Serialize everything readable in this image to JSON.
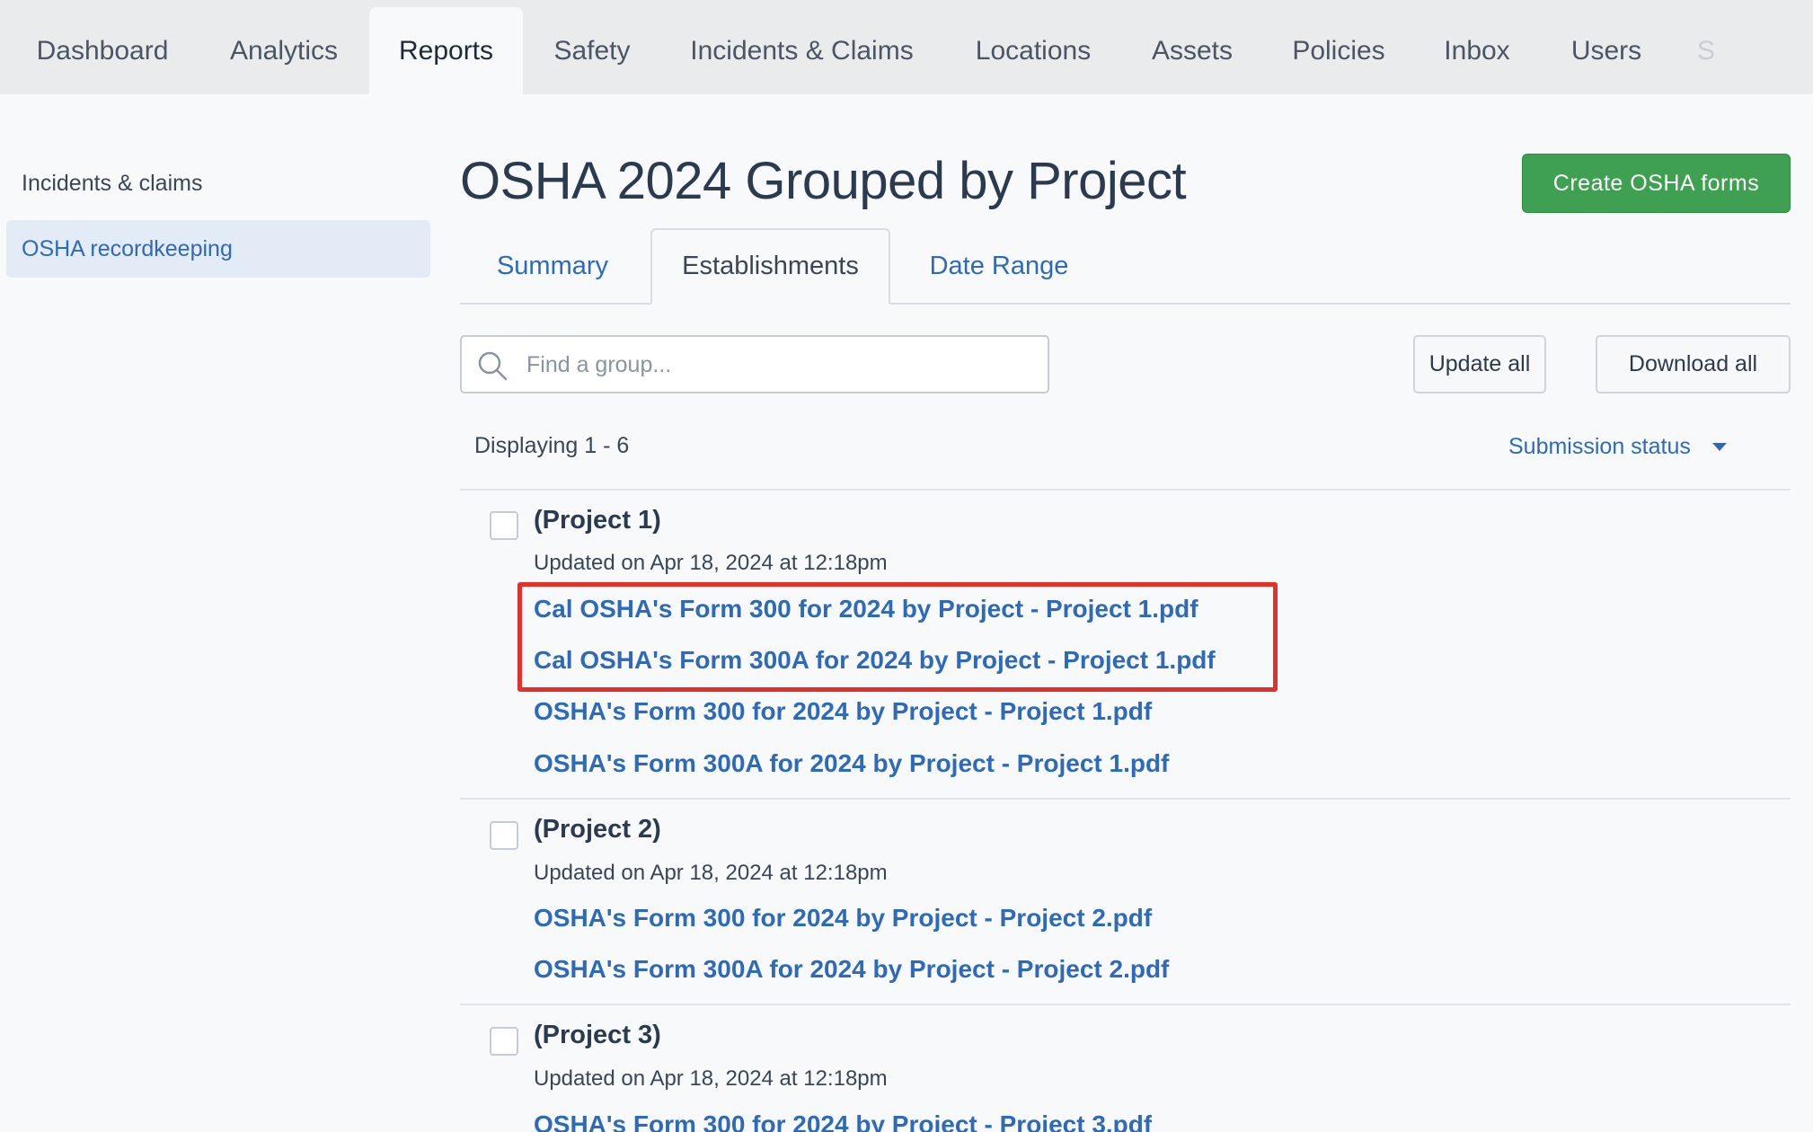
{
  "topnav": {
    "tabs": [
      {
        "label": "Dashboard"
      },
      {
        "label": "Analytics"
      },
      {
        "label": "Reports"
      },
      {
        "label": "Safety"
      },
      {
        "label": "Incidents & Claims"
      },
      {
        "label": "Locations"
      },
      {
        "label": "Assets"
      },
      {
        "label": "Policies"
      },
      {
        "label": "Inbox"
      },
      {
        "label": "Users"
      },
      {
        "label": "S"
      }
    ],
    "active": "Reports"
  },
  "sidebar": {
    "items": [
      {
        "label": "Incidents & claims"
      },
      {
        "label": "OSHA recordkeeping"
      }
    ]
  },
  "main": {
    "title": "OSHA 2024 Grouped by Project",
    "create_button": "Create OSHA forms",
    "tabs": [
      {
        "label": "Summary"
      },
      {
        "label": "Establishments"
      },
      {
        "label": "Date Range"
      }
    ],
    "search_placeholder": "Find a group...",
    "update_all": "Update all",
    "download_all": "Download all",
    "displaying": "Displaying 1 - 6",
    "status_filter": "Submission status",
    "groups": [
      {
        "title": "(Project 1)",
        "updated": "Updated on Apr 18, 2024 at 12:18pm",
        "files": [
          "Cal OSHA's Form 300 for 2024 by Project - Project 1.pdf",
          "Cal OSHA's Form 300A for 2024 by Project - Project 1.pdf",
          "OSHA's Form 300 for 2024 by Project - Project 1.pdf",
          "OSHA's Form 300A for 2024 by Project - Project 1.pdf"
        ]
      },
      {
        "title": "(Project 2)",
        "updated": "Updated on Apr 18, 2024 at 12:18pm",
        "files": [
          "OSHA's Form 300 for 2024 by Project - Project 2.pdf",
          "OSHA's Form 300A for 2024 by Project - Project 2.pdf"
        ]
      },
      {
        "title": "(Project 3)",
        "updated": "Updated on Apr 18, 2024 at 12:18pm",
        "files": [
          "OSHA's Form 300 for 2024 by Project - Project 3.pdf"
        ]
      }
    ]
  },
  "colors": {
    "accent_link": "#2f6ab8",
    "primary_button": "#3fa051",
    "highlight_box": "#e4302a"
  }
}
